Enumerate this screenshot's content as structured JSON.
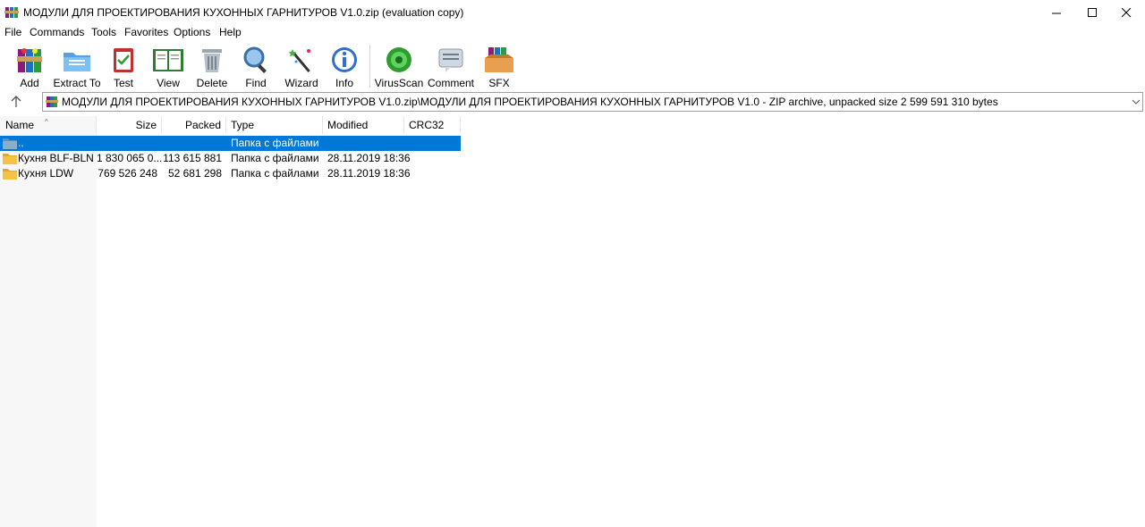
{
  "window": {
    "title": "МОДУЛИ ДЛЯ ПРОЕКТИРОВАНИЯ КУХОННЫХ ГАРНИТУРОВ V1.0.zip (evaluation copy)"
  },
  "menu": [
    "File",
    "Commands",
    "Tools",
    "Favorites",
    "Options",
    "Help"
  ],
  "toolbar": {
    "add": "Add",
    "extract": "Extract To",
    "test": "Test",
    "view": "View",
    "delete": "Delete",
    "find": "Find",
    "wizard": "Wizard",
    "info": "Info",
    "virusscan": "VirusScan",
    "comment": "Comment",
    "sfx": "SFX"
  },
  "address": {
    "path": "МОДУЛИ ДЛЯ ПРОЕКТИРОВАНИЯ КУХОННЫХ ГАРНИТУРОВ V1.0.zip\\МОДУЛИ ДЛЯ ПРОЕКТИРОВАНИЯ КУХОННЫХ ГАРНИТУРОВ V1.0 - ZIP archive, unpacked size 2 599 591 310 bytes"
  },
  "columns": {
    "name": "Name",
    "size": "Size",
    "packed": "Packed",
    "type": "Type",
    "modified": "Modified",
    "crc": "CRC32"
  },
  "rows": [
    {
      "name": "..",
      "size": "",
      "packed": "",
      "type": "Папка с файлами",
      "modified": ""
    },
    {
      "name": "Кухня BLF-BLN",
      "size": "1 830 065 0...",
      "packed": "113 615 881",
      "type": "Папка с файлами",
      "modified": "28.11.2019 18:36"
    },
    {
      "name": "Кухня LDW",
      "size": "769 526 248",
      "packed": "52 681 298",
      "type": "Папка с файлами",
      "modified": "28.11.2019 18:36"
    }
  ],
  "colors": {
    "selection": "#0078d7",
    "folder": "#f4c244"
  }
}
